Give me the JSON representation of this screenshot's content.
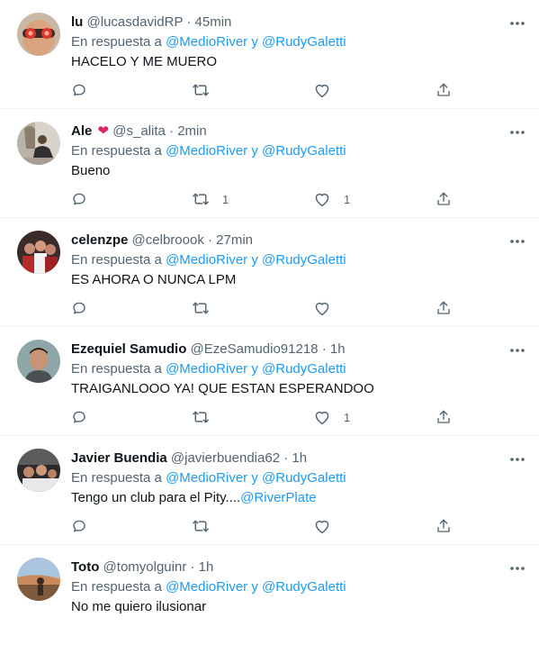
{
  "tweets": [
    {
      "name": "lu",
      "has_heart": false,
      "handle": "@lucasdavidRP",
      "time": "45min",
      "reply_prefix": "En respuesta a",
      "mention1": "@MedioRiver",
      "reply_and": "y",
      "mention2": "@RudyGaletti",
      "text": "HACELO Y ME MUERO",
      "text_mention": "",
      "retweets": "",
      "likes": ""
    },
    {
      "name": "Ale",
      "has_heart": true,
      "heart": "❤",
      "handle": "@s_alita",
      "time": "2min",
      "reply_prefix": "En respuesta a",
      "mention1": "@MedioRiver",
      "reply_and": "y",
      "mention2": "@RudyGaletti",
      "text": "Bueno",
      "text_mention": "",
      "retweets": "1",
      "likes": "1"
    },
    {
      "name": "celenzpe",
      "has_heart": false,
      "handle": "@celbroook",
      "time": "27min",
      "reply_prefix": "En respuesta a",
      "mention1": "@MedioRiver",
      "reply_and": "y",
      "mention2": "@RudyGaletti",
      "text": "ES AHORA O NUNCA LPM",
      "text_mention": "",
      "retweets": "",
      "likes": ""
    },
    {
      "name": "Ezequiel Samudio",
      "has_heart": false,
      "handle": "@EzeSamudio91218",
      "time": "1h",
      "reply_prefix": "En respuesta a",
      "mention1": "@MedioRiver",
      "reply_and": "y",
      "mention2": "@RudyGaletti",
      "text": "TRAIGANLOOO YA! QUE ESTAN ESPERANDOO",
      "text_mention": "",
      "retweets": "",
      "likes": "1"
    },
    {
      "name": "Javier Buendia",
      "has_heart": false,
      "handle": "@javierbuendia62",
      "time": "1h",
      "reply_prefix": "En respuesta a",
      "mention1": "@MedioRiver",
      "reply_and": "y",
      "mention2": "@RudyGaletti",
      "text": "Tengo un club para el Pity....",
      "text_mention": "@RiverPlate",
      "retweets": "",
      "likes": ""
    },
    {
      "name": "Toto",
      "has_heart": false,
      "handle": "@tomyolguinr",
      "time": "1h",
      "reply_prefix": "En respuesta a",
      "mention1": "@MedioRiver",
      "reply_and": "y",
      "mention2": "@RudyGaletti",
      "text": "No me quiero ilusionar",
      "text_mention": "",
      "retweets": "",
      "likes": ""
    }
  ],
  "icons": {
    "more": "more-icon",
    "reply": "reply-icon",
    "retweet": "retweet-icon",
    "like": "like-icon",
    "share": "share-icon"
  },
  "colors": {
    "text": "#0f1419",
    "secondary": "#536471",
    "link": "#1d9bf0",
    "heart": "#e0245e",
    "divider": "#eff3f4"
  }
}
